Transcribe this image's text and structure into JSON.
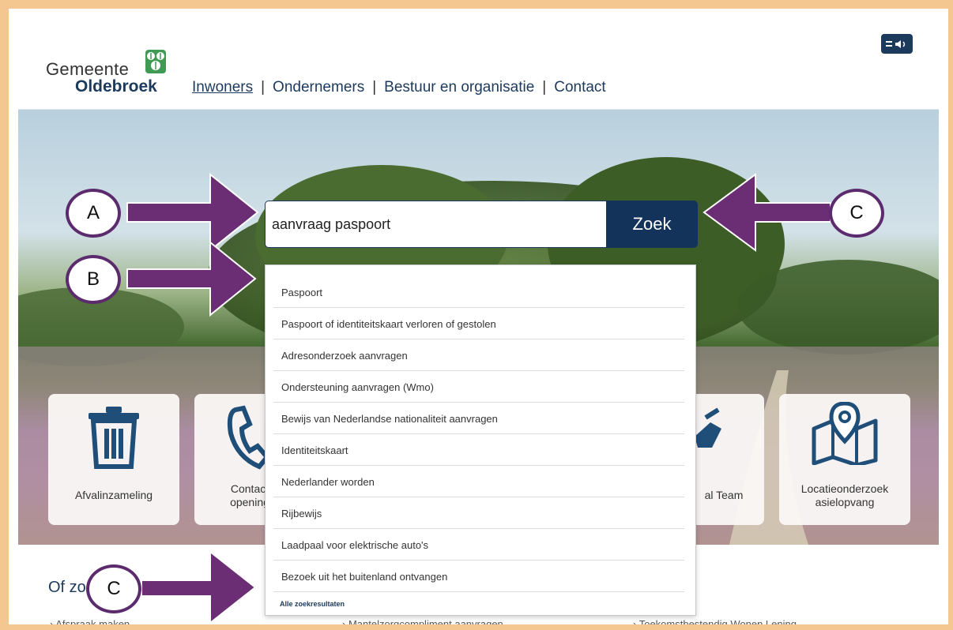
{
  "header": {
    "logo_line1": "Gemeente",
    "logo_line2": "Oldebroek",
    "nav": [
      "Inwoners",
      "Ondernemers",
      "Bestuur en organisatie",
      "Contact"
    ]
  },
  "search": {
    "value": "aanvraag paspoort",
    "button_label": "Zoek"
  },
  "suggestions": {
    "items": [
      "Paspoort",
      "Paspoort of identiteitskaart verloren of gestolen",
      "Adresonderzoek aanvragen",
      "Ondersteuning aanvragen (Wmo)",
      "Bewijs van Nederlandse nationaliteit aanvragen",
      "Identiteitskaart",
      "Nederlander worden",
      "Rijbewijs",
      "Laadpaal voor elektrische auto's",
      "Bezoek uit het buitenland ontvangen"
    ],
    "all_results": "Alle zoekresultaten"
  },
  "tiles": [
    {
      "label": "Afvalinzameling",
      "icon": "trash-icon"
    },
    {
      "label": "Contact opening",
      "icon": "phone-icon"
    },
    {
      "label": "al Team",
      "icon": "handshake-icon"
    },
    {
      "label": "Locatieonderzoek asielopvang",
      "icon": "map-pin-icon"
    }
  ],
  "bottom": {
    "heading": "Of zoe",
    "links": [
      "Afspraak maken",
      "Mantelzorgcompliment aanvragen",
      "Toekomstbestendig Wonen Lening"
    ]
  },
  "annotations": [
    "A",
    "B",
    "C",
    "C"
  ],
  "colors": {
    "brand_navy": "#13335a",
    "annotation_purple": "#5b2b6e",
    "frame_orange": "#f3c78f"
  }
}
